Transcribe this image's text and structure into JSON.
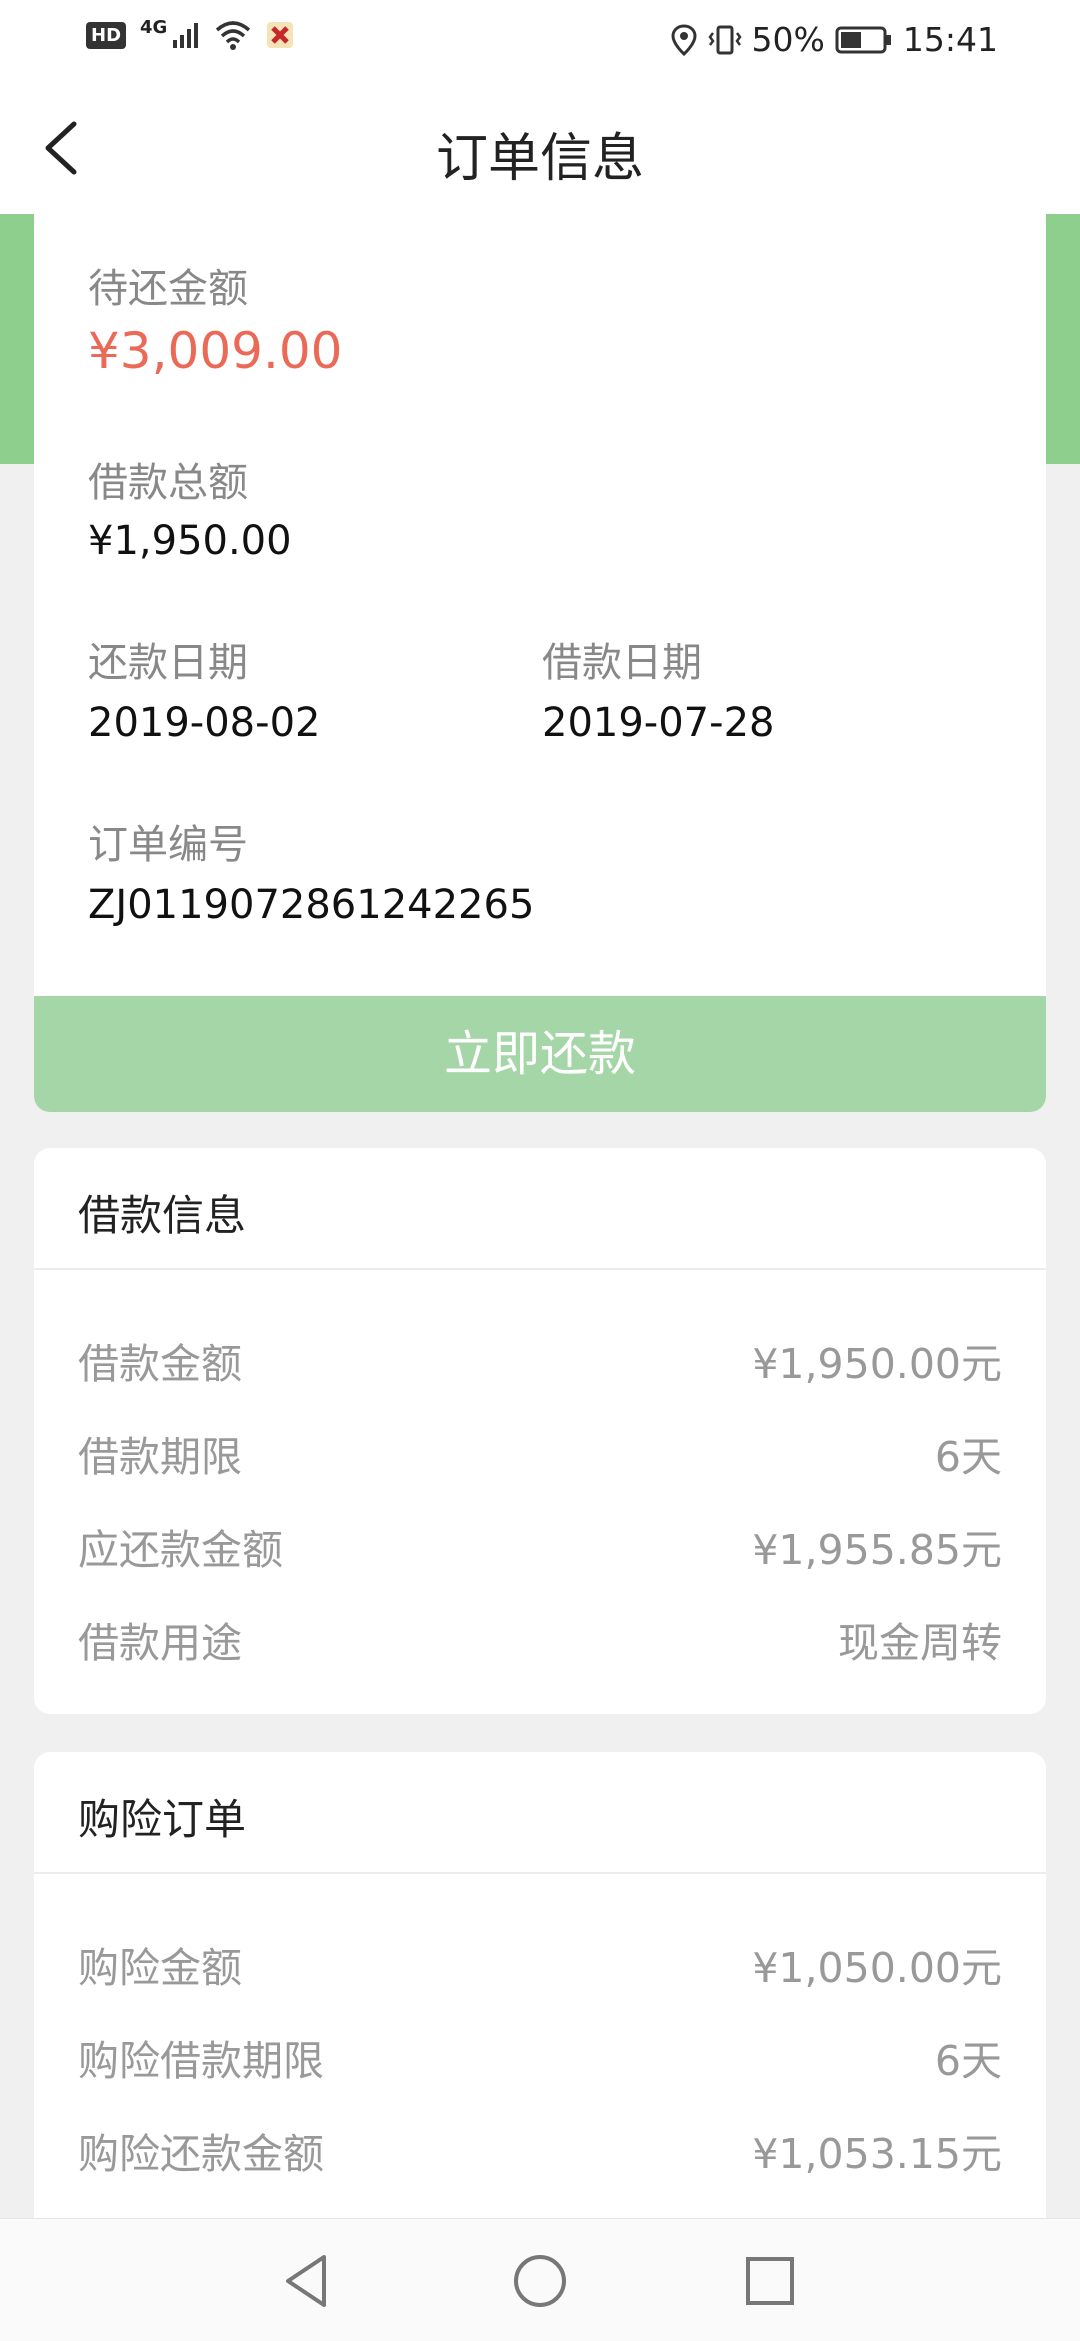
{
  "status_bar": {
    "hd": "HD",
    "network": "4G",
    "battery": "50%",
    "time": "15:41",
    "icons": [
      "signal-icon",
      "wifi-icon",
      "app-notification-icon",
      "location-icon",
      "vibrate-icon",
      "battery-icon"
    ]
  },
  "header": {
    "title": "订单信息",
    "back_icon": "chevron-left-icon"
  },
  "summary": {
    "pending_label": "待还金额",
    "pending_amount": "¥3,009.00",
    "loan_total_label": "借款总额",
    "loan_total": "¥1,950.00",
    "repay_date_label": "还款日期",
    "repay_date": "2019-08-02",
    "loan_date_label": "借款日期",
    "loan_date": "2019-07-28",
    "order_no_label": "订单编号",
    "order_no": "ZJ0119072861242265"
  },
  "repay_button": "立即还款",
  "loan_info": {
    "title": "借款信息",
    "rows": [
      {
        "label": "借款金额",
        "value": "¥1,950.00元"
      },
      {
        "label": "借款期限",
        "value": "6天"
      },
      {
        "label": "应还款金额",
        "value": "¥1,955.85元"
      },
      {
        "label": "借款用途",
        "value": "现金周转"
      }
    ]
  },
  "insurance_order": {
    "title": "购险订单",
    "rows": [
      {
        "label": "购险金额",
        "value": "¥1,050.00元"
      },
      {
        "label": "购险借款期限",
        "value": "6天"
      },
      {
        "label": "购险还款金额",
        "value": "¥1,053.15元"
      }
    ]
  },
  "colors": {
    "accent_green": "#8fcf8d",
    "button_green": "#a5d6a7",
    "amount_red": "#ea6a57"
  },
  "bottom_nav": [
    "back-triangle-icon",
    "home-circle-icon",
    "recents-square-icon"
  ]
}
